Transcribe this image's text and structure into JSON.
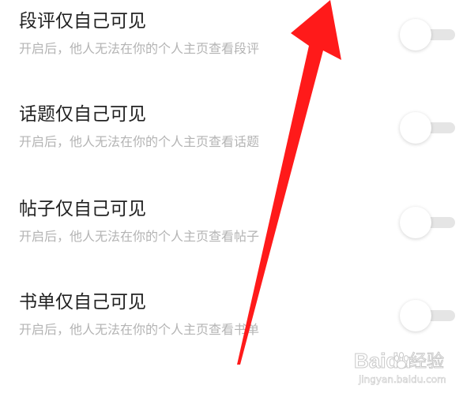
{
  "settings": [
    {
      "title": "段评仅自己可见",
      "description": "开启后，他人无法在你的个人主页查看段评",
      "enabled": false
    },
    {
      "title": "话题仅自己可见",
      "description": "开启后，他人无法在你的个人主页查看话题",
      "enabled": false
    },
    {
      "title": "帖子仅自己可见",
      "description": "开启后，他人无法在你的个人主页查看帖子",
      "enabled": false
    },
    {
      "title": "书单仅自己可见",
      "description": "开启后，他人无法在你的个人主页查看书单",
      "enabled": false
    }
  ],
  "annotation": {
    "arrow_color": "#ff1a1a"
  },
  "watermark": {
    "logo": "Baidu",
    "label": "经验",
    "url": "jingyan.baidu.com"
  },
  "colors": {
    "title": "#222222",
    "description": "#b4b4b4",
    "toggle_track": "#e5e5e5",
    "background": "#ffffff"
  }
}
